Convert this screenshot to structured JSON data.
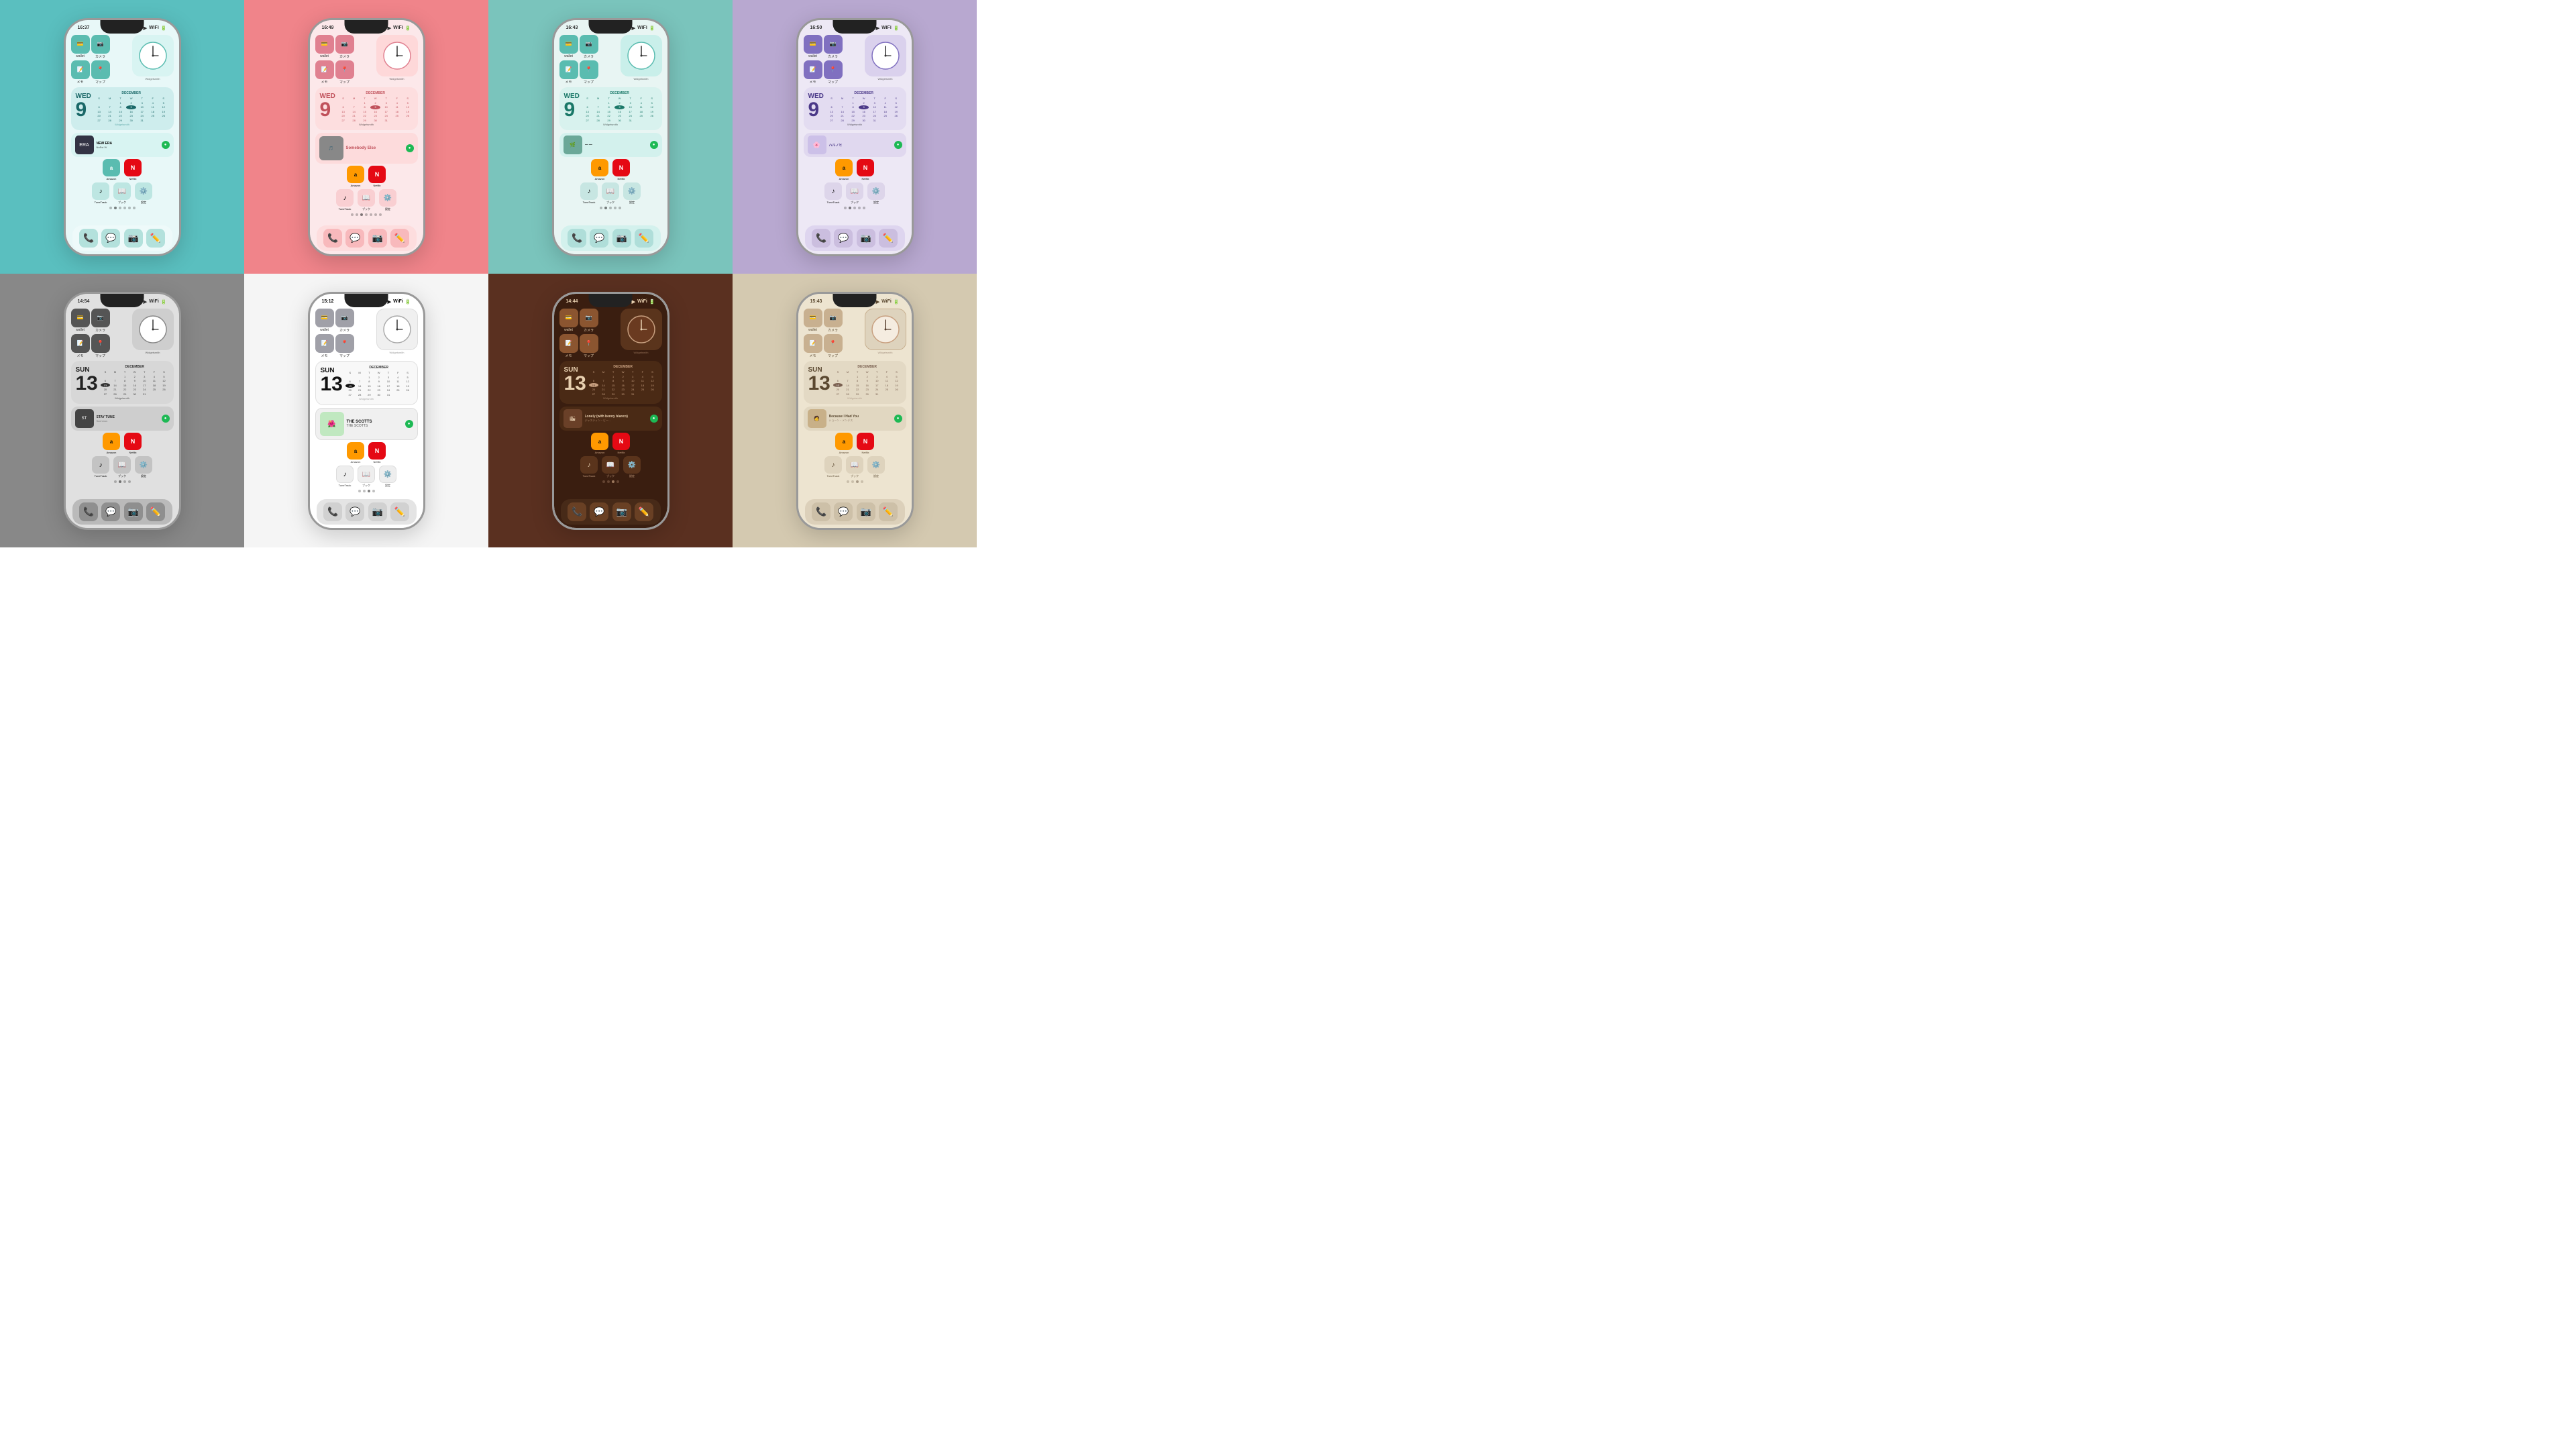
{
  "themes": [
    {
      "id": "teal",
      "bg": "#5abfbf",
      "time": "16:37",
      "calDay": "WED",
      "calNum": "9",
      "calMonth": "DECEMBER",
      "calDark": false,
      "musicTitle": "NEW ERA",
      "musicArtist": "NuEstW",
      "musicBig": false,
      "dockClass": "dock-teal",
      "calClass": "cal-teal",
      "calTextColor": "#1a6868",
      "iconTint": "light",
      "bottomBg": "rgba(255,255,255,0.3)"
    },
    {
      "id": "pink",
      "bg": "#f0848a",
      "time": "16:49",
      "calDay": "WED",
      "calNum": "9",
      "calMonth": "DECEMBER",
      "calDark": false,
      "musicTitle": "Somebody Else",
      "musicArtist": "",
      "musicBig": true,
      "dockClass": "dock-pink",
      "calClass": "cal-pink",
      "calTextColor": "#a03040",
      "iconTint": "light",
      "bottomBg": "rgba(255,200,200,0.4)"
    },
    {
      "id": "mint",
      "bg": "#7ac4bc",
      "time": "16:43",
      "calDay": "WED",
      "calNum": "9",
      "calMonth": "DECEMBER",
      "calDark": false,
      "musicTitle": "",
      "musicArtist": "",
      "musicBig": false,
      "dockClass": "dock-mint",
      "calClass": "cal-mint",
      "calTextColor": "#1a6858",
      "iconTint": "light",
      "bottomBg": "rgba(200,240,235,0.4)"
    },
    {
      "id": "purple",
      "bg": "#b8a8d0",
      "time": "16:50",
      "calDay": "WED",
      "calNum": "9",
      "calMonth": "DECEMBER",
      "calDark": false,
      "musicTitle": "ハルノヒ",
      "musicArtist": "",
      "musicBig": false,
      "dockClass": "dock-purple",
      "calClass": "cal-purple",
      "calTextColor": "#4a3888",
      "iconTint": "light",
      "bottomBg": "rgba(220,210,240,0.4)"
    },
    {
      "id": "gray",
      "bg": "#888888",
      "time": "14:54",
      "calDay": "SUN",
      "calNum": "13",
      "calMonth": "DECEMBER",
      "calDark": true,
      "musicTitle": "STAY TUNE",
      "musicArtist": "Suchmos",
      "musicBig": false,
      "dockClass": "dock-gray",
      "calClass": "cal-gray",
      "calTextColor": "#222",
      "iconTint": "dark",
      "bottomBg": "rgba(60,60,60,0.4)"
    },
    {
      "id": "white",
      "bg": "#f5f5f5",
      "time": "15:12",
      "calDay": "SUN",
      "calNum": "13",
      "calMonth": "DECEMBER",
      "calDark": false,
      "musicTitle": "THE SCOTTS",
      "musicArtist": "THE SCOTTS",
      "musicBig": true,
      "dockClass": "dock-white",
      "calClass": "cal-white",
      "calTextColor": "#111",
      "iconTint": "dark",
      "bottomBg": "rgba(220,220,220,0.5)"
    },
    {
      "id": "brown",
      "bg": "#5a3020",
      "time": "14:44",
      "calDay": "SUN",
      "calNum": "13",
      "calMonth": "DECEMBER",
      "calDark": true,
      "musicTitle": "Lonely (with benny blanco)",
      "musicArtist": "ジャスティン・ビー…",
      "musicBig": false,
      "dockClass": "dock-brown",
      "calClass": "cal-brown",
      "calTextColor": "#e8d0b0",
      "iconTint": "warm",
      "bottomBg": "rgba(80,50,35,0.5)"
    },
    {
      "id": "beige",
      "bg": "#d4c9b0",
      "time": "15:43",
      "calDay": "SUN",
      "calNum": "13",
      "calMonth": "DECEMBER",
      "calDark": false,
      "musicTitle": "Because I Had You",
      "musicArtist": "ショーン・メンデス",
      "musicBig": false,
      "dockClass": "dock-beige",
      "calClass": "cal-beige",
      "calTextColor": "#4a3820",
      "iconTint": "neutral",
      "bottomBg": "rgba(200,185,160,0.4)"
    }
  ],
  "calDays": [
    "S",
    "M",
    "T",
    "W",
    "T",
    "F",
    "S"
  ],
  "calGridDec9": [
    " ",
    " ",
    "1",
    "2",
    "3",
    "4",
    "5",
    "6",
    "7",
    "8",
    "9",
    "10",
    "11",
    "12",
    "13",
    "14",
    "15",
    "16",
    "17",
    "18",
    "19",
    "20",
    "21",
    "22",
    "23",
    "24",
    "25",
    "26",
    "27",
    "28",
    "29",
    "30",
    "31"
  ],
  "calGridDec13": [
    " ",
    " ",
    "1",
    "2",
    "3",
    "4",
    "5",
    "6",
    "7",
    "8",
    "9",
    "10",
    "11",
    "12",
    "13",
    "14",
    "15",
    "16",
    "17",
    "18",
    "19",
    "20",
    "21",
    "22",
    "23",
    "24",
    "25",
    "26",
    "27",
    "28",
    "29",
    "30",
    "31"
  ],
  "dockIcons": [
    "📞",
    "💬",
    "📷",
    "✏️"
  ],
  "appIcons": {
    "wallet": "💳",
    "camera": "📷",
    "memo": "📝",
    "map": "🗺️",
    "amazon": "a",
    "netflix": "N",
    "tunetrack": "♪",
    "book": "📖",
    "settings": "⚙️",
    "spotify": "●"
  }
}
